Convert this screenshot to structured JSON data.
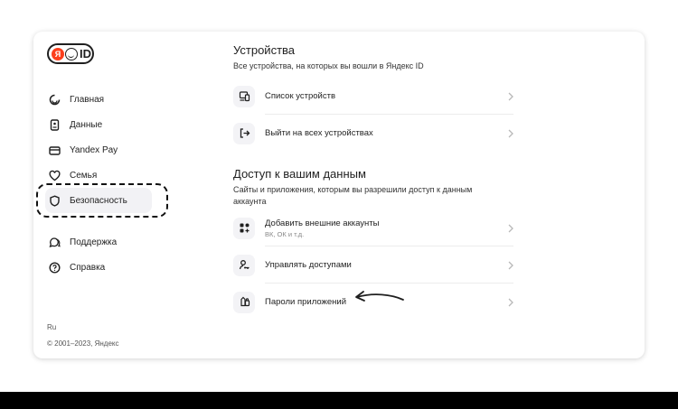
{
  "logo": {
    "ya": "Я",
    "id": "ID"
  },
  "sidebar": {
    "items": [
      {
        "label": "Главная",
        "icon": "home-icon"
      },
      {
        "label": "Данные",
        "icon": "document-icon"
      },
      {
        "label": "Yandex Pay",
        "icon": "card-icon"
      },
      {
        "label": "Семья",
        "icon": "heart-icon"
      },
      {
        "label": "Безопасность",
        "icon": "shield-icon",
        "active": true
      }
    ],
    "secondary": [
      {
        "label": "Поддержка",
        "icon": "chat-icon"
      },
      {
        "label": "Справка",
        "icon": "help-icon"
      }
    ],
    "language": "Ru",
    "copyright": "© 2001–2023, Яндекс"
  },
  "devices": {
    "title": "Устройства",
    "description": "Все устройства, на которых вы вошли в Яндекс ID",
    "rows": [
      {
        "label": "Список устройств",
        "icon": "devices-icon"
      },
      {
        "label": "Выйти на всех устройствах",
        "icon": "logout-icon"
      }
    ]
  },
  "access": {
    "title": "Доступ к вашим данным",
    "description": "Сайты и приложения, которым вы разрешили доступ к данным аккаунта",
    "rows": [
      {
        "label": "Добавить внешние аккаунты",
        "sublabel": "ВК, ОК и т.д.",
        "icon": "apps-icon"
      },
      {
        "label": "Управлять доступами",
        "icon": "user-key-icon"
      },
      {
        "label": "Пароли приложений",
        "icon": "app-password-icon"
      }
    ]
  },
  "colors": {
    "accent": "#fc3f1d",
    "active_bg": "#f2f2f5",
    "icon_bg": "#f3f3f6"
  }
}
